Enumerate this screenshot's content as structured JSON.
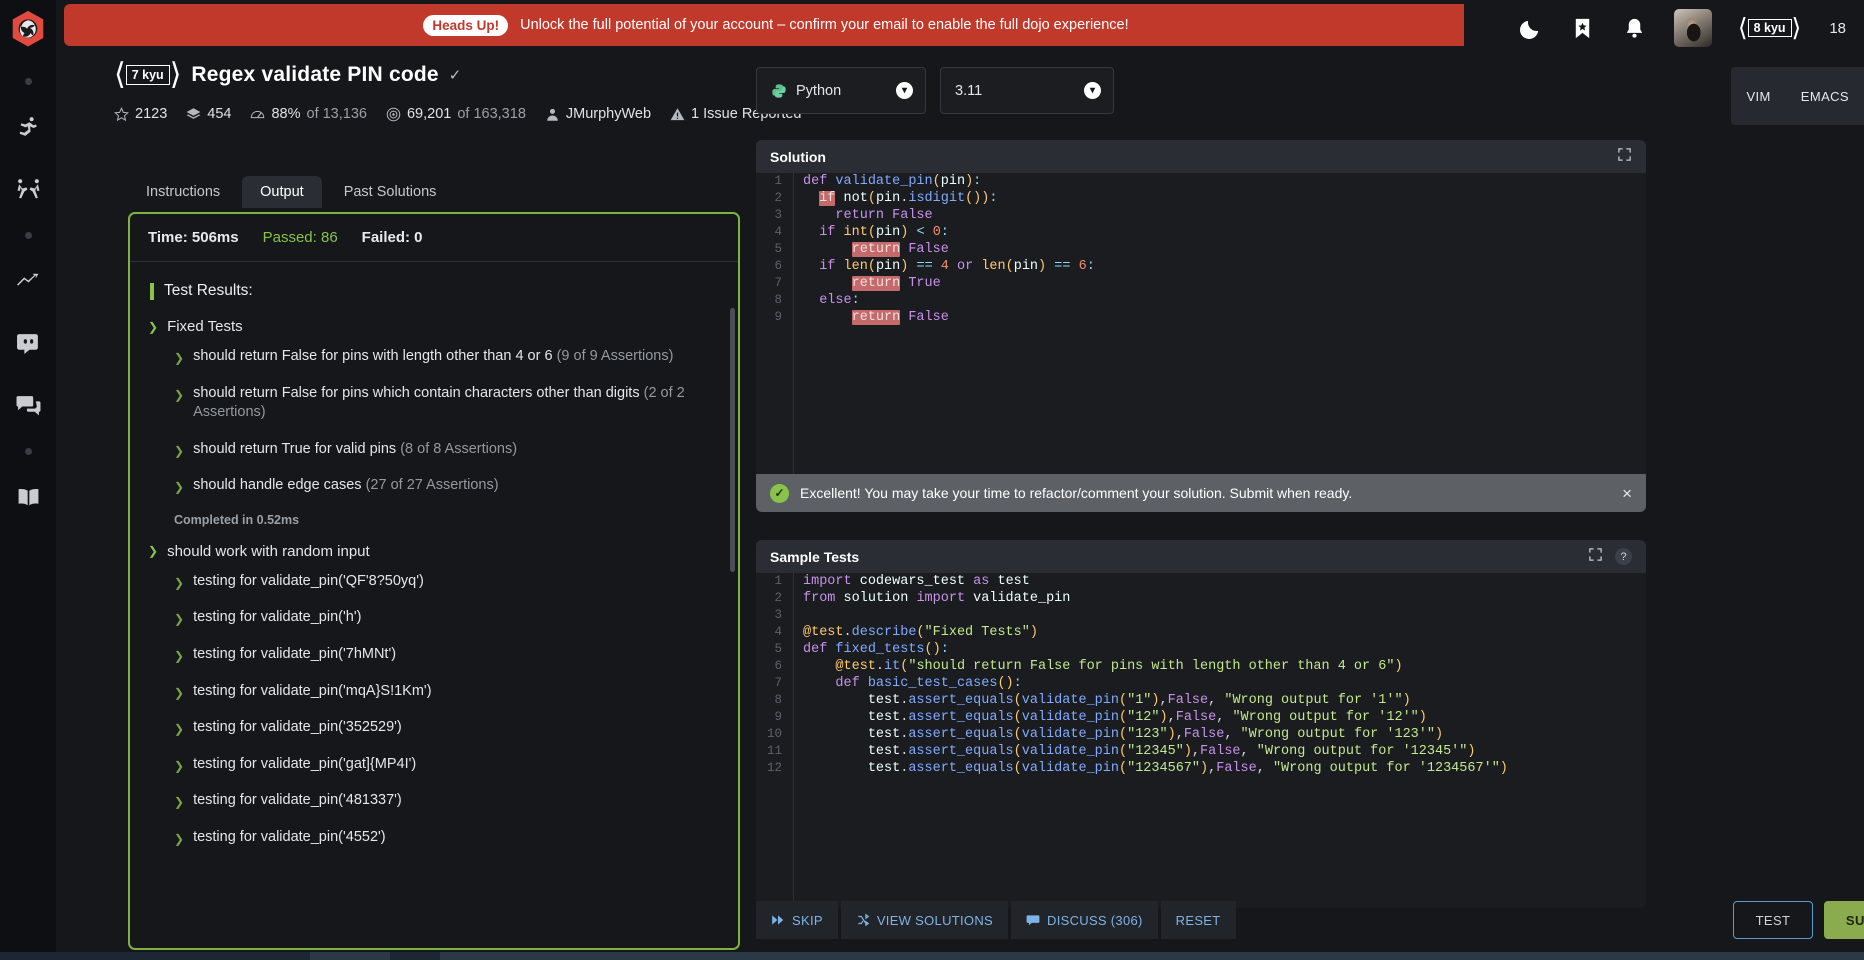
{
  "banner": {
    "tag": "Heads Up!",
    "text": "Unlock the full potential of your account – confirm your email to enable the full dojo experience!"
  },
  "topbar": {
    "icons": [
      "moon-icon",
      "bookmark-icon",
      "bell-icon"
    ],
    "rank": "8 kyu",
    "honor": "18"
  },
  "sidebar": {
    "items": [
      "codewars-logo",
      "kata-icon",
      "kumite-icon",
      "leaderboard-icon",
      "discord-icon",
      "forum-icon",
      "docs-icon"
    ]
  },
  "challenge": {
    "rank": "7 kyu",
    "title": "Regex validate PIN code",
    "stats": {
      "stars": "2123",
      "collections": "454",
      "satisfaction_pct": "88%",
      "satisfaction_of": "of 13,136",
      "completed": "69,201",
      "completed_of": "of 163,318",
      "author": "JMurphyWeb",
      "issues": "1 Issue Reported"
    }
  },
  "left_panel": {
    "tabs": [
      {
        "label": "Instructions",
        "active": false
      },
      {
        "label": "Output",
        "active": true
      },
      {
        "label": "Past Solutions",
        "active": false
      }
    ],
    "summary": {
      "time": "Time: 506ms",
      "passed": "Passed: 86",
      "failed": "Failed: 0"
    },
    "results_title": "Test Results:",
    "groups": [
      {
        "name": "Fixed Tests",
        "tests": [
          {
            "label": "should return False for pins with length other than 4 or 6",
            "assertions": "(9 of 9 Assertions)"
          },
          {
            "label": "should return False for pins which contain characters other than digits",
            "assertions": "(2 of 2 Assertions)"
          },
          {
            "label": "should return True for valid pins",
            "assertions": "(8 of 8 Assertions)"
          },
          {
            "label": "should handle edge cases",
            "assertions": "(27 of 27 Assertions)"
          }
        ],
        "completed": "Completed in 0.52ms"
      },
      {
        "name": "should work with random input",
        "tests": [
          {
            "label": "testing for validate_pin('QF'8?50yq')",
            "assertions": ""
          },
          {
            "label": "testing for validate_pin('h')",
            "assertions": ""
          },
          {
            "label": "testing for validate_pin('7hMNt')",
            "assertions": ""
          },
          {
            "label": "testing for validate_pin('mqA}S!1Km')",
            "assertions": ""
          },
          {
            "label": "testing for validate_pin('352529')",
            "assertions": ""
          },
          {
            "label": "testing for validate_pin('gat]{MP4I')",
            "assertions": ""
          },
          {
            "label": "testing for validate_pin('481337')",
            "assertions": ""
          },
          {
            "label": "testing for validate_pin('4552')",
            "assertions": ""
          }
        ],
        "completed": ""
      }
    ]
  },
  "editor": {
    "language": "Python",
    "version": "3.11",
    "modes": [
      "VIM",
      "EMACS"
    ],
    "solution_title": "Solution",
    "sample_tests_title": "Sample Tests",
    "message": "Excellent! You may take your time to refactor/comment your solution. Submit when ready.",
    "message_close": "×"
  },
  "actions": {
    "skip": "SKIP",
    "view_solutions": "VIEW SOLUTIONS",
    "discuss": "DISCUSS (306)",
    "reset": "RESET",
    "test": "TEST",
    "submit": "SUBMIT"
  },
  "colors": {
    "accent_green": "#8bc34a",
    "banner_red": "#c0392b",
    "link_blue": "#7fb3e8",
    "submit_green": "#8aac4e"
  }
}
